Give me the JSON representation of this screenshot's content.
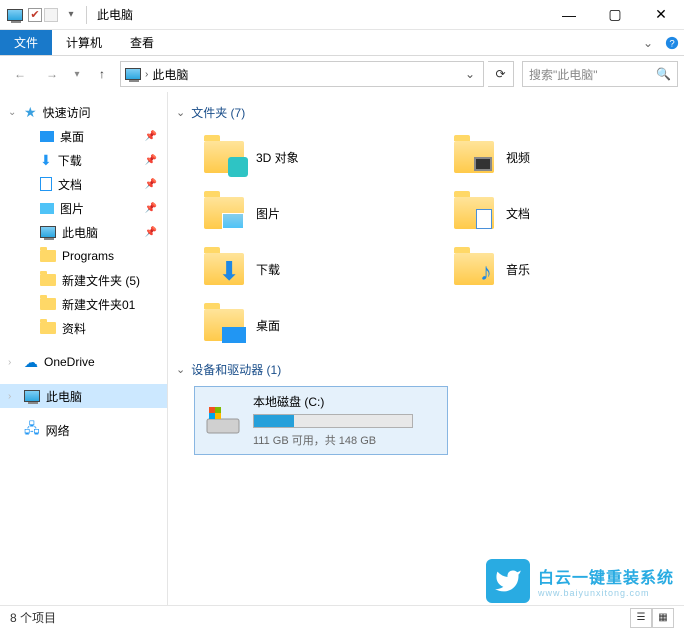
{
  "title": "此电脑",
  "ribbon": {
    "file": "文件",
    "computer": "计算机",
    "view": "查看"
  },
  "nav": {
    "location": "此电脑",
    "search_placeholder": "搜索\"此电脑\""
  },
  "sidebar": {
    "quick": "快速访问",
    "items": [
      "桌面",
      "下载",
      "文档",
      "图片",
      "此电脑",
      "Programs",
      "新建文件夹 (5)",
      "新建文件夹01",
      "资料"
    ],
    "onedrive": "OneDrive",
    "thispc": "此电脑",
    "network": "网络"
  },
  "groups": {
    "folders": {
      "title": "文件夹 (7)",
      "items": [
        "3D 对象",
        "视频",
        "图片",
        "文档",
        "下载",
        "音乐",
        "桌面"
      ]
    },
    "drives": {
      "title": "设备和驱动器 (1)",
      "items": [
        {
          "name": "本地磁盘 (C:)",
          "used_pct": 25,
          "status": "111 GB 可用，共 148 GB"
        }
      ]
    }
  },
  "status": "8 个项目",
  "watermark": {
    "l1": "白云一键重装系统",
    "l2": "www.baiyunxitong.com"
  }
}
